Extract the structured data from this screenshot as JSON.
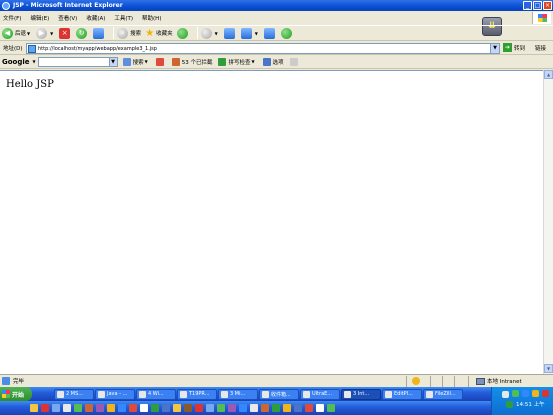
{
  "window": {
    "title": "JSP - Microsoft Internet Explorer"
  },
  "menu": [
    "文件(F)",
    "编辑(E)",
    "查看(V)",
    "收藏(A)",
    "工具(T)",
    "帮助(H)"
  ],
  "toolbar": {
    "back_label": "后退",
    "search_label": "搜索",
    "favorites_label": "收藏夹"
  },
  "address": {
    "label": "地址(D)",
    "url": "http://localhost/myapp/webapp/example3_1.jsp",
    "go_label": "转到",
    "links_label": "链接"
  },
  "google": {
    "logo": "Google",
    "search_label": "搜索",
    "blocked_label": "53 个已拦截",
    "spellcheck_label": "拼写检查",
    "options_label": "选项"
  },
  "page": {
    "content": "Hello JSP"
  },
  "status": {
    "text": "完毕",
    "zone": "本地 Intranet"
  },
  "taskbar": {
    "start_label": "开始",
    "tasks": [
      "2 MS...",
      "Java - ...",
      "4 Wi...",
      "T19PR...",
      "3 Mi...",
      "收件箱...",
      "UltraE...",
      "3 Int...",
      "EditPl...",
      "FileZill..."
    ],
    "clock": "14:51 上午"
  },
  "colors": {
    "titlebar": "#0a4fd4",
    "taskbar": "#245edb",
    "start": "#2d8d2f"
  }
}
